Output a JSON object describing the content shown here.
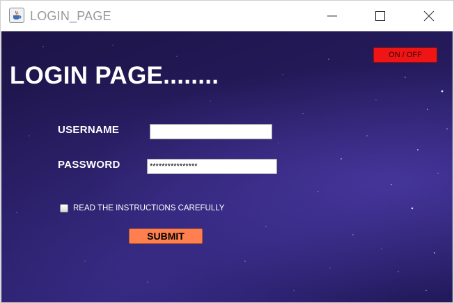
{
  "window": {
    "title": "LOGIN_PAGE",
    "controls": [
      "minimize-icon",
      "maximize-icon",
      "close-icon"
    ],
    "app_icon": "java-cup-icon"
  },
  "main": {
    "heading": "LOGIN PAGE........",
    "toggle_label": "ON / OFF",
    "username_label": "USERNAME",
    "username_value": "",
    "password_label": "PASSWORD",
    "password_value": "****************",
    "checkbox_label": "READ THE INSTRUCTIONS CAREFULLY",
    "checkbox_checked": false,
    "submit_label": "SUBMIT"
  },
  "colors": {
    "background": "#241a5a",
    "toggle": "#f01515",
    "submit": "#ff7f4f",
    "text": "#ffffff"
  }
}
